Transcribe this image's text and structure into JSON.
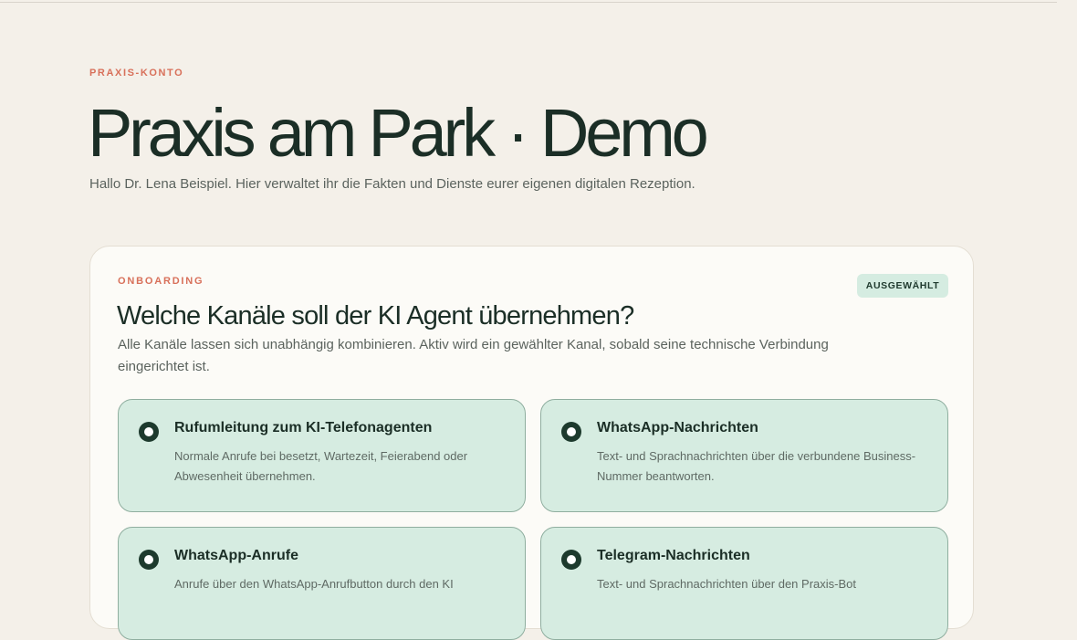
{
  "header": {
    "eyebrow": "PRAXIS-KONTO",
    "title": "Praxis am Park · Demo",
    "intro": "Hallo Dr. Lena Beispiel. Hier verwaltet ihr die Fakten und Dienste eurer eigenen digitalen Rezeption."
  },
  "card": {
    "eyebrow": "ONBOARDING",
    "badge": "AUSGEWÄHLT",
    "title": "Welche Kanäle soll der KI Agent übernehmen?",
    "description": "Alle Kanäle lassen sich unabhängig kombinieren. Aktiv wird ein gewählter Kanal, sobald seine technische Verbindung eingerichtet ist.",
    "options": [
      {
        "title": "Rufumleitung zum KI-Telefonagenten",
        "description": "Normale Anrufe bei besetzt, Wartezeit, Feierabend oder Abwesenheit übernehmen.",
        "selected": true
      },
      {
        "title": "WhatsApp-Nachrichten",
        "description": "Text- und Sprachnachrichten über die verbundene Business-Nummer beantworten.",
        "selected": true
      },
      {
        "title": "WhatsApp-Anrufe",
        "description": "Anrufe über den WhatsApp-Anrufbutton durch den KI",
        "selected": true
      },
      {
        "title": "Telegram-Nachrichten",
        "description": "Text- und Sprachnachrichten über den Praxis-Bot",
        "selected": true
      }
    ]
  },
  "colors": {
    "background": "#f4f0e9",
    "accent": "#d8705a",
    "option_fill": "#d6ece1",
    "radio": "#1d3a2d"
  }
}
